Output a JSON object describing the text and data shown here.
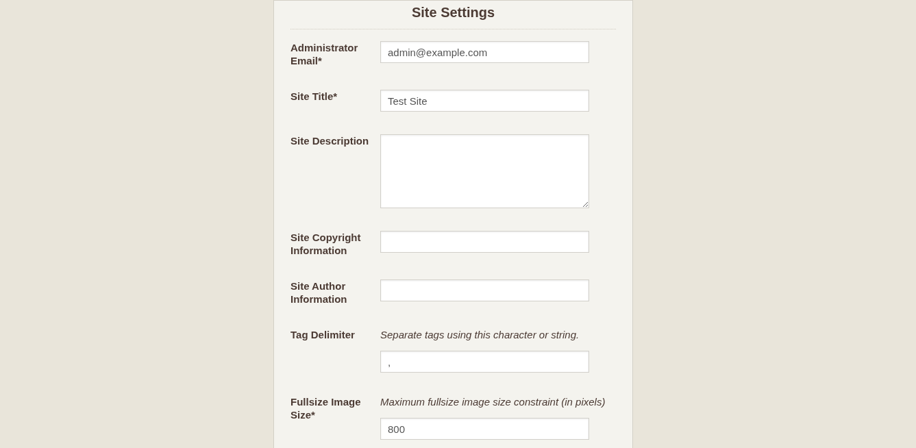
{
  "panel": {
    "title": "Site Settings"
  },
  "fields": [
    {
      "kind": "input",
      "label": "Administrator Email*",
      "value": "admin@example.com"
    },
    {
      "kind": "input",
      "label": "Site Title*",
      "value": "Test Site"
    },
    {
      "kind": "textarea",
      "label": "Site Description"
    },
    {
      "kind": "input",
      "label": "Site Copyright Information"
    },
    {
      "kind": "input",
      "label": "Site Author Information"
    },
    {
      "kind": "input",
      "label": "Tag Delimiter",
      "hint": "Separate tags using this character or string.",
      "value": ","
    },
    {
      "kind": "input",
      "label": "Fullsize Image Size*",
      "hint": "Maximum fullsize image size constraint (in pixels)",
      "value": "800"
    }
  ]
}
